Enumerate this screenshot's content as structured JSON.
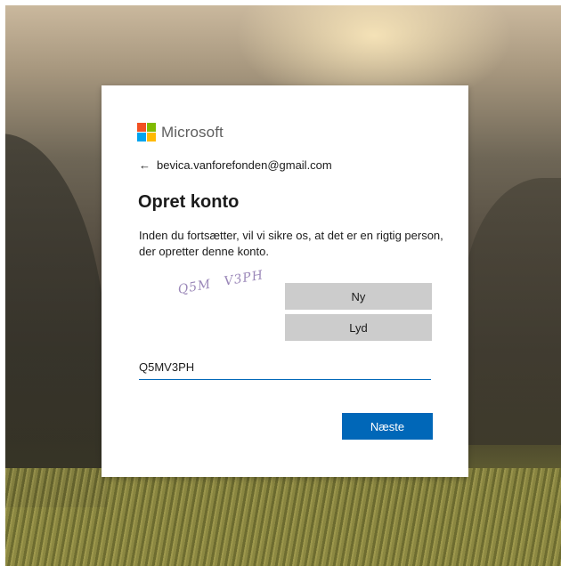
{
  "logo": {
    "name": "Microsoft",
    "colors": [
      "#f25022",
      "#7fba00",
      "#00a4ef",
      "#ffb900"
    ]
  },
  "account": {
    "back_icon": "arrow-left-icon",
    "email": "bevica.vanforefonden@gmail.com"
  },
  "page": {
    "title": "Opret konto",
    "description": "Inden du fortsætter, vil vi sikre os, at det er en rigtig person, der opretter denne konto."
  },
  "captcha": {
    "image_text": "Q5M V3PH",
    "new_label": "Ny",
    "audio_label": "Lyd"
  },
  "input": {
    "value": "Q5MV3PH"
  },
  "actions": {
    "next_label": "Næste"
  },
  "colors": {
    "accent": "#0067b8",
    "button_gray": "#cccccc"
  }
}
